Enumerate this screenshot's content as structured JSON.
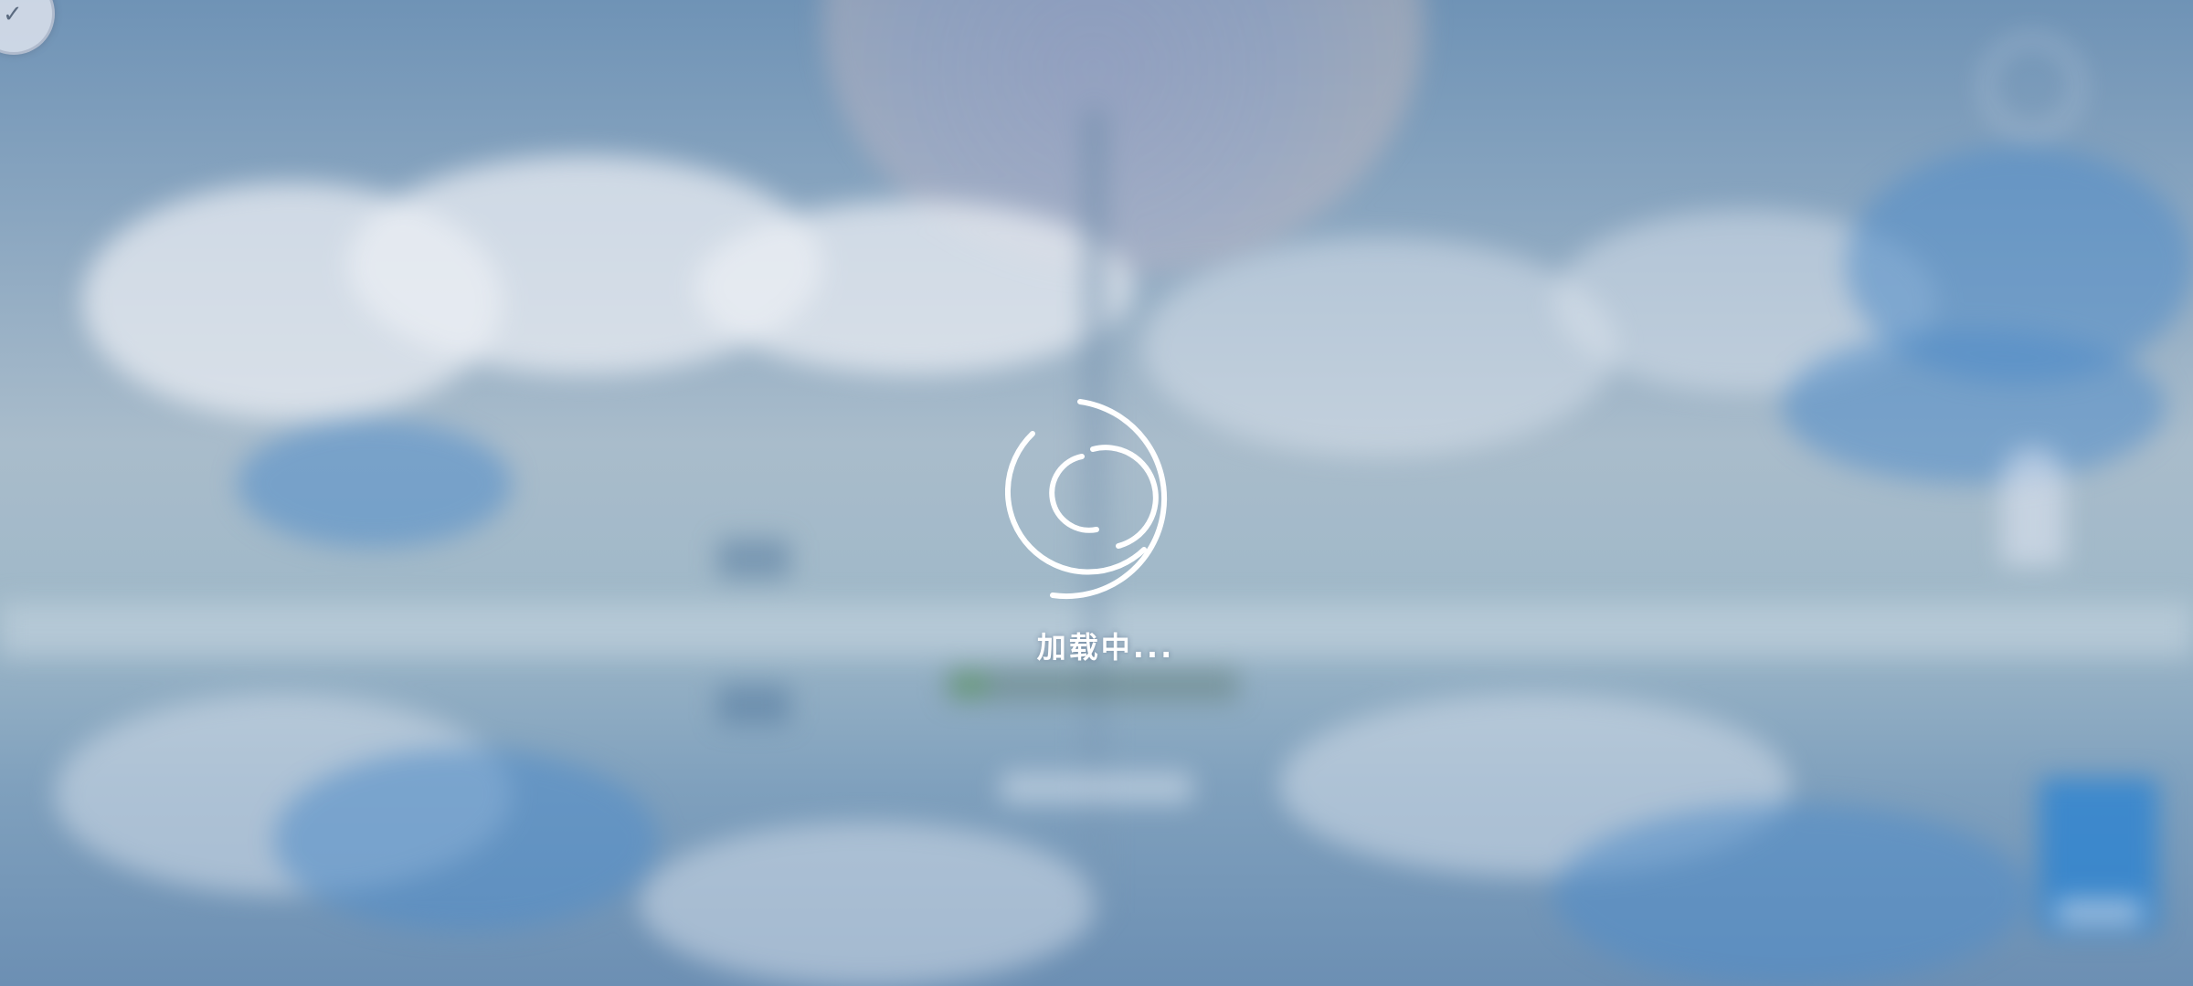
{
  "loading": {
    "text": "加载中..."
  },
  "icons": {
    "corner": "shield-check-icon",
    "spinner": "loading-spinner-icon"
  },
  "colors": {
    "spinner": "#ffffff",
    "loading_text": "#ffffff"
  }
}
